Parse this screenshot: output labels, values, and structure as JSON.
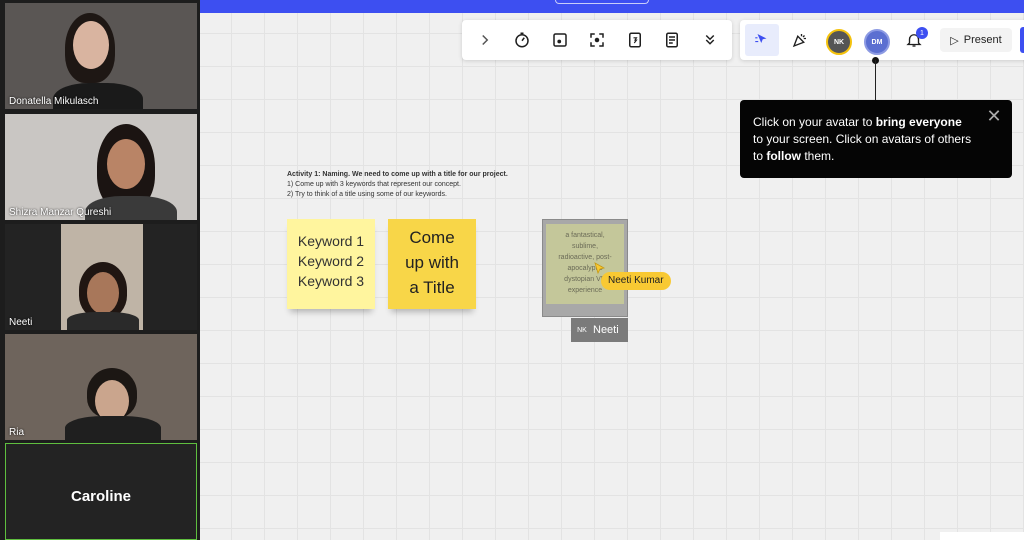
{
  "participants": [
    {
      "name": "Donatella Mikulasch"
    },
    {
      "name": "Shizra Manzar Qureshi"
    },
    {
      "name": "Neeti"
    },
    {
      "name": "Ria"
    },
    {
      "name": "Caroline"
    }
  ],
  "toolbar": {
    "present_label": "Present",
    "notification_count": "1",
    "avatars": [
      {
        "initials": "NK",
        "color": "#f4c20d"
      },
      {
        "initials": "DM",
        "color": "#5b6fd1"
      }
    ]
  },
  "tooltip": {
    "part1": "Click on your avatar to ",
    "bold1": "bring everyone",
    "part2": " to your screen. Click on avatars of others to ",
    "bold2": "follow",
    "part3": " them."
  },
  "board": {
    "activity_title": "Activity 1: Naming. We need to come up with a title for our project.",
    "activity_line1": "1) Come up with 3 keywords that represent our concept.",
    "activity_line2": "2) Try to think of a title using some of our keywords.",
    "sticky1": [
      "Keyword 1",
      "Keyword 2",
      "Keyword 3"
    ],
    "sticky2": [
      "Come",
      "up with",
      "a Title"
    ],
    "sticky3": [
      "a fantastical,",
      "sublime,",
      "radioactive, post-",
      "apocalyptic",
      "dystopian VR",
      "experience"
    ],
    "tag_initials": "NK",
    "tag_name": "Neeti",
    "cursor_label": "Neeti Kumar"
  },
  "colors": {
    "brand": "#3d4ff1",
    "sticky_light": "#fff59e",
    "sticky_yellow": "#f8d648",
    "cursor": "#f8c933"
  }
}
